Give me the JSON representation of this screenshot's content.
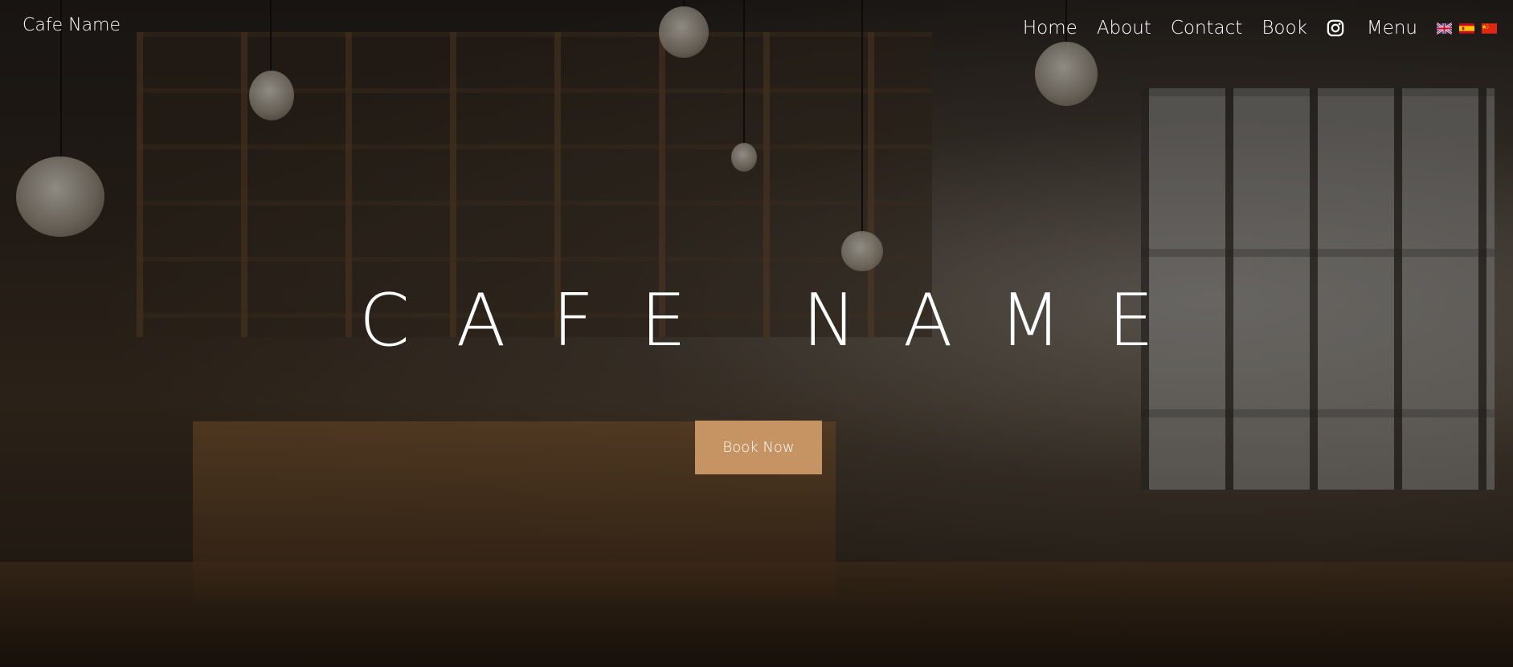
{
  "navbar": {
    "brand": "Cafe Name",
    "links": [
      "Home",
      "About",
      "Contact",
      "Book"
    ],
    "instagram_icon": "instagram-icon",
    "menu_label": "Menu",
    "languages": [
      {
        "icon": "uk-flag-icon",
        "code": "en"
      },
      {
        "icon": "spain-flag-icon",
        "code": "es"
      },
      {
        "icon": "china-flag-icon",
        "code": "zh"
      }
    ]
  },
  "hero": {
    "title": "CAFE NAME",
    "cta_label": "Book Now",
    "background_image": "cafe-interior-background"
  },
  "colors": {
    "cta_background": "#c59462",
    "text": "#ffffff",
    "overlay": "rgba(0,0,0,0.42)"
  }
}
